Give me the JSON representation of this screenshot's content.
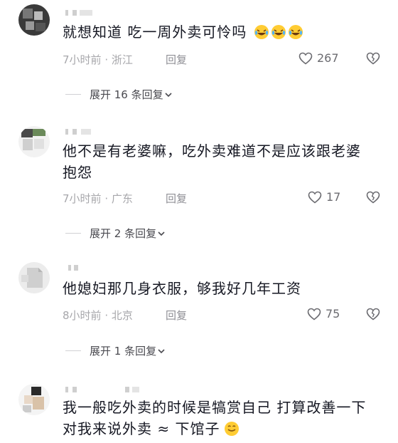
{
  "comments": [
    {
      "text": "就想知道 吃一周外卖可怜吗",
      "time": "7小时前",
      "location": "浙江",
      "reply_label": "回复",
      "likes": "267",
      "expand_label": "展开 16 条回复"
    },
    {
      "text": "他不是有老婆嘛，吃外卖难道不是应该跟老婆抱怨",
      "time": "7小时前",
      "location": "广东",
      "reply_label": "回复",
      "likes": "17",
      "expand_label": "展开 2 条回复"
    },
    {
      "text": "他媳妇那几身衣服，够我好几年工资",
      "time": "8小时前",
      "location": "北京",
      "reply_label": "回复",
      "likes": "75",
      "expand_label": "展开 1 条回复"
    },
    {
      "text_line1": "我一般吃外卖的时候是犒赏自己 打算改善一下",
      "text_line2": "对我来说外卖 ≈ 下馆子"
    }
  ],
  "icons": {
    "like": "heart-outline-icon",
    "dislike": "broken-heart-icon",
    "expand": "chevron-down-icon",
    "laugh_cry": "laughing-crying-emoji",
    "smile": "smile-emoji"
  },
  "colors": {
    "text": "#161823",
    "meta": "#a7a7ab",
    "icon": "#6b6b70"
  }
}
